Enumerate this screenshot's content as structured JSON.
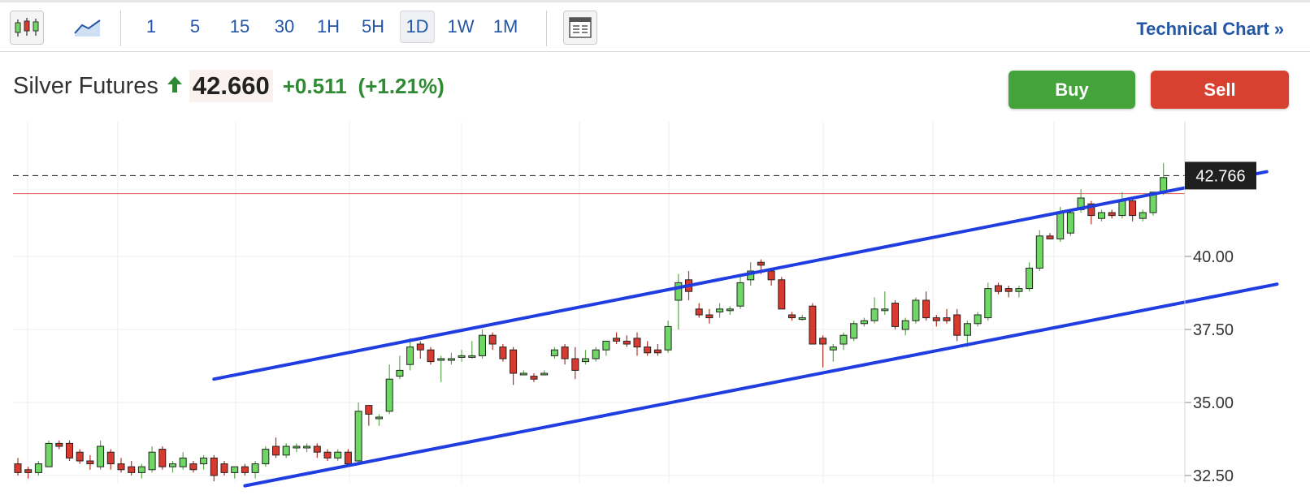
{
  "toolbar": {
    "chart_type_icons": [
      "candlestick-icon",
      "area-chart-icon"
    ],
    "intervals": [
      "1",
      "5",
      "15",
      "30",
      "1H",
      "5H",
      "1D",
      "1W",
      "1M"
    ],
    "active_interval": "1D",
    "layout_icon": "layout-icon",
    "technical_chart_label": "Technical Chart",
    "technical_chart_icon": "»"
  },
  "quote": {
    "name": "Silver Futures",
    "direction_icon": "up-arrow-icon",
    "price": "42.660",
    "change": "+0.511",
    "change_pct": "(+1.21%)",
    "up_color": "#2f8a34"
  },
  "actions": {
    "buy_label": "Buy",
    "sell_label": "Sell",
    "buy_color": "#44a33a",
    "sell_color": "#d8412f"
  },
  "chart_data": {
    "type": "candlestick",
    "title": "",
    "y_ticks": [
      "40.00",
      "37.50",
      "35.00",
      "32.50"
    ],
    "ylim": [
      32.3,
      44.0
    ],
    "price_tag": "42.766",
    "current_price_line": 42.766,
    "previous_close_line": 42.149,
    "up_color": "#6fd764",
    "down_color": "#d93a2f",
    "trendline_color": "#1f3de0",
    "trendlines": [
      {
        "from": {
          "bar": 19,
          "price": 35.8
        },
        "to": {
          "bar": 121,
          "price": 42.9
        }
      },
      {
        "from": {
          "bar": 22,
          "price": 32.15
        },
        "to": {
          "bar": 122,
          "price": 39.05
        }
      }
    ],
    "candles": [
      {
        "o": 32.9,
        "h": 33.1,
        "l": 32.5,
        "c": 32.6
      },
      {
        "o": 32.7,
        "h": 32.8,
        "l": 32.4,
        "c": 32.6
      },
      {
        "o": 32.6,
        "h": 33.0,
        "l": 32.5,
        "c": 32.9
      },
      {
        "o": 32.8,
        "h": 33.7,
        "l": 32.8,
        "c": 33.6
      },
      {
        "o": 33.6,
        "h": 33.7,
        "l": 33.4,
        "c": 33.5
      },
      {
        "o": 33.6,
        "h": 33.7,
        "l": 33.0,
        "c": 33.1
      },
      {
        "o": 33.3,
        "h": 33.4,
        "l": 32.9,
        "c": 33.0
      },
      {
        "o": 33.0,
        "h": 33.2,
        "l": 32.7,
        "c": 32.9
      },
      {
        "o": 32.8,
        "h": 33.7,
        "l": 32.7,
        "c": 33.5
      },
      {
        "o": 33.3,
        "h": 33.4,
        "l": 32.7,
        "c": 32.9
      },
      {
        "o": 32.9,
        "h": 33.1,
        "l": 32.6,
        "c": 32.7
      },
      {
        "o": 32.8,
        "h": 33.0,
        "l": 32.5,
        "c": 32.6
      },
      {
        "o": 32.6,
        "h": 32.9,
        "l": 32.4,
        "c": 32.8
      },
      {
        "o": 32.7,
        "h": 33.5,
        "l": 32.6,
        "c": 33.3
      },
      {
        "o": 33.4,
        "h": 33.5,
        "l": 32.7,
        "c": 32.8
      },
      {
        "o": 32.8,
        "h": 33.0,
        "l": 32.6,
        "c": 32.9
      },
      {
        "o": 32.8,
        "h": 33.3,
        "l": 32.7,
        "c": 33.1
      },
      {
        "o": 32.9,
        "h": 33.0,
        "l": 32.6,
        "c": 32.7
      },
      {
        "o": 32.9,
        "h": 33.2,
        "l": 32.7,
        "c": 33.1
      },
      {
        "o": 33.1,
        "h": 33.2,
        "l": 32.3,
        "c": 32.5
      },
      {
        "o": 32.9,
        "h": 33.0,
        "l": 32.5,
        "c": 32.6
      },
      {
        "o": 32.6,
        "h": 32.8,
        "l": 32.4,
        "c": 32.8
      },
      {
        "o": 32.8,
        "h": 32.9,
        "l": 32.5,
        "c": 32.6
      },
      {
        "o": 32.6,
        "h": 33.0,
        "l": 32.4,
        "c": 32.9
      },
      {
        "o": 32.9,
        "h": 33.5,
        "l": 32.8,
        "c": 33.4
      },
      {
        "o": 33.5,
        "h": 33.8,
        "l": 33.1,
        "c": 33.2
      },
      {
        "o": 33.2,
        "h": 33.6,
        "l": 33.1,
        "c": 33.5
      },
      {
        "o": 33.5,
        "h": 33.6,
        "l": 33.3,
        "c": 33.5
      },
      {
        "o": 33.5,
        "h": 33.6,
        "l": 33.3,
        "c": 33.5
      },
      {
        "o": 33.5,
        "h": 33.6,
        "l": 33.1,
        "c": 33.3
      },
      {
        "o": 33.3,
        "h": 33.4,
        "l": 33.0,
        "c": 33.1
      },
      {
        "o": 33.1,
        "h": 33.4,
        "l": 33.0,
        "c": 33.3
      },
      {
        "o": 33.3,
        "h": 33.4,
        "l": 32.8,
        "c": 32.9
      },
      {
        "o": 33.0,
        "h": 35.0,
        "l": 32.9,
        "c": 34.7
      },
      {
        "o": 34.9,
        "h": 34.9,
        "l": 34.2,
        "c": 34.6
      },
      {
        "o": 34.5,
        "h": 34.6,
        "l": 34.2,
        "c": 34.5
      },
      {
        "o": 34.7,
        "h": 36.3,
        "l": 34.6,
        "c": 35.8
      },
      {
        "o": 35.9,
        "h": 36.6,
        "l": 35.8,
        "c": 36.1
      },
      {
        "o": 36.3,
        "h": 37.2,
        "l": 36.1,
        "c": 36.9
      },
      {
        "o": 37.0,
        "h": 37.1,
        "l": 36.5,
        "c": 36.8
      },
      {
        "o": 36.8,
        "h": 36.9,
        "l": 36.3,
        "c": 36.4
      },
      {
        "o": 36.5,
        "h": 36.6,
        "l": 35.7,
        "c": 36.5
      },
      {
        "o": 36.5,
        "h": 36.7,
        "l": 36.3,
        "c": 36.5
      },
      {
        "o": 36.6,
        "h": 36.8,
        "l": 36.4,
        "c": 36.6
      },
      {
        "o": 36.6,
        "h": 37.1,
        "l": 36.5,
        "c": 36.6
      },
      {
        "o": 36.6,
        "h": 37.5,
        "l": 36.5,
        "c": 37.3
      },
      {
        "o": 37.3,
        "h": 37.4,
        "l": 36.8,
        "c": 37.0
      },
      {
        "o": 36.9,
        "h": 37.0,
        "l": 36.4,
        "c": 36.5
      },
      {
        "o": 36.8,
        "h": 36.9,
        "l": 35.6,
        "c": 36.0
      },
      {
        "o": 36.0,
        "h": 36.1,
        "l": 36.0,
        "c": 36.0
      },
      {
        "o": 35.9,
        "h": 36.0,
        "l": 35.7,
        "c": 35.8
      },
      {
        "o": 36.0,
        "h": 36.1,
        "l": 36.0,
        "c": 36.0
      },
      {
        "o": 36.6,
        "h": 36.9,
        "l": 36.5,
        "c": 36.8
      },
      {
        "o": 36.9,
        "h": 37.0,
        "l": 36.3,
        "c": 36.5
      },
      {
        "o": 36.5,
        "h": 36.9,
        "l": 35.8,
        "c": 36.1
      },
      {
        "o": 36.4,
        "h": 36.8,
        "l": 36.3,
        "c": 36.5
      },
      {
        "o": 36.5,
        "h": 36.9,
        "l": 36.4,
        "c": 36.8
      },
      {
        "o": 36.8,
        "h": 37.1,
        "l": 36.6,
        "c": 37.1
      },
      {
        "o": 37.2,
        "h": 37.4,
        "l": 37.0,
        "c": 37.1
      },
      {
        "o": 37.1,
        "h": 37.3,
        "l": 36.9,
        "c": 37.0
      },
      {
        "o": 37.2,
        "h": 37.4,
        "l": 36.6,
        "c": 36.9
      },
      {
        "o": 36.9,
        "h": 37.1,
        "l": 36.6,
        "c": 36.7
      },
      {
        "o": 36.8,
        "h": 37.0,
        "l": 36.6,
        "c": 36.7
      },
      {
        "o": 36.8,
        "h": 37.8,
        "l": 36.7,
        "c": 37.6
      },
      {
        "o": 38.5,
        "h": 39.4,
        "l": 37.5,
        "c": 39.1
      },
      {
        "o": 39.2,
        "h": 39.5,
        "l": 38.5,
        "c": 38.8
      },
      {
        "o": 38.2,
        "h": 38.4,
        "l": 37.9,
        "c": 38.0
      },
      {
        "o": 38.0,
        "h": 38.2,
        "l": 37.7,
        "c": 37.9
      },
      {
        "o": 38.1,
        "h": 38.4,
        "l": 37.9,
        "c": 38.2
      },
      {
        "o": 38.2,
        "h": 38.3,
        "l": 38.0,
        "c": 38.2
      },
      {
        "o": 38.3,
        "h": 39.4,
        "l": 38.2,
        "c": 39.1
      },
      {
        "o": 39.2,
        "h": 39.8,
        "l": 39.0,
        "c": 39.5
      },
      {
        "o": 39.8,
        "h": 39.9,
        "l": 39.4,
        "c": 39.7
      },
      {
        "o": 39.5,
        "h": 39.6,
        "l": 39.0,
        "c": 39.2
      },
      {
        "o": 39.2,
        "h": 39.3,
        "l": 38.2,
        "c": 38.2
      },
      {
        "o": 38.0,
        "h": 38.1,
        "l": 37.8,
        "c": 37.9
      },
      {
        "o": 37.9,
        "h": 38.0,
        "l": 37.8,
        "c": 37.9
      },
      {
        "o": 38.3,
        "h": 38.4,
        "l": 37.1,
        "c": 37.0
      },
      {
        "o": 37.2,
        "h": 37.3,
        "l": 36.2,
        "c": 37.0
      },
      {
        "o": 36.8,
        "h": 37.0,
        "l": 36.4,
        "c": 36.9
      },
      {
        "o": 37.0,
        "h": 37.4,
        "l": 36.8,
        "c": 37.3
      },
      {
        "o": 37.2,
        "h": 37.8,
        "l": 37.1,
        "c": 37.7
      },
      {
        "o": 37.7,
        "h": 37.9,
        "l": 37.6,
        "c": 37.8
      },
      {
        "o": 37.8,
        "h": 38.6,
        "l": 37.7,
        "c": 38.2
      },
      {
        "o": 38.2,
        "h": 38.8,
        "l": 38.0,
        "c": 38.2
      },
      {
        "o": 38.4,
        "h": 38.5,
        "l": 37.5,
        "c": 37.6
      },
      {
        "o": 37.5,
        "h": 37.9,
        "l": 37.3,
        "c": 37.8
      },
      {
        "o": 37.8,
        "h": 38.6,
        "l": 37.7,
        "c": 38.5
      },
      {
        "o": 38.5,
        "h": 38.8,
        "l": 37.8,
        "c": 37.9
      },
      {
        "o": 37.9,
        "h": 38.0,
        "l": 37.6,
        "c": 37.8
      },
      {
        "o": 37.9,
        "h": 38.2,
        "l": 37.7,
        "c": 37.8
      },
      {
        "o": 38.0,
        "h": 38.2,
        "l": 37.1,
        "c": 37.3
      },
      {
        "o": 37.3,
        "h": 37.8,
        "l": 36.9,
        "c": 37.7
      },
      {
        "o": 37.7,
        "h": 38.1,
        "l": 37.6,
        "c": 38.0
      },
      {
        "o": 37.9,
        "h": 39.1,
        "l": 37.8,
        "c": 38.9
      },
      {
        "o": 39.0,
        "h": 39.1,
        "l": 38.7,
        "c": 38.8
      },
      {
        "o": 38.9,
        "h": 39.0,
        "l": 38.6,
        "c": 38.8
      },
      {
        "o": 38.8,
        "h": 39.0,
        "l": 38.6,
        "c": 38.9
      },
      {
        "o": 38.9,
        "h": 39.8,
        "l": 38.8,
        "c": 39.6
      },
      {
        "o": 39.6,
        "h": 40.9,
        "l": 39.5,
        "c": 40.7
      },
      {
        "o": 40.7,
        "h": 40.8,
        "l": 40.6,
        "c": 40.6
      },
      {
        "o": 40.6,
        "h": 41.7,
        "l": 40.5,
        "c": 41.5
      },
      {
        "o": 40.8,
        "h": 41.6,
        "l": 40.7,
        "c": 41.5
      },
      {
        "o": 41.6,
        "h": 42.3,
        "l": 41.5,
        "c": 42.0
      },
      {
        "o": 41.8,
        "h": 41.9,
        "l": 41.1,
        "c": 41.4
      },
      {
        "o": 41.3,
        "h": 41.6,
        "l": 41.2,
        "c": 41.5
      },
      {
        "o": 41.5,
        "h": 41.6,
        "l": 41.3,
        "c": 41.4
      },
      {
        "o": 41.4,
        "h": 42.2,
        "l": 41.3,
        "c": 41.9
      },
      {
        "o": 41.9,
        "h": 42.0,
        "l": 41.2,
        "c": 41.4
      },
      {
        "o": 41.3,
        "h": 41.6,
        "l": 41.2,
        "c": 41.5
      },
      {
        "o": 41.5,
        "h": 42.2,
        "l": 41.4,
        "c": 42.2
      },
      {
        "o": 42.2,
        "h": 43.2,
        "l": 42.1,
        "c": 42.7
      }
    ]
  }
}
